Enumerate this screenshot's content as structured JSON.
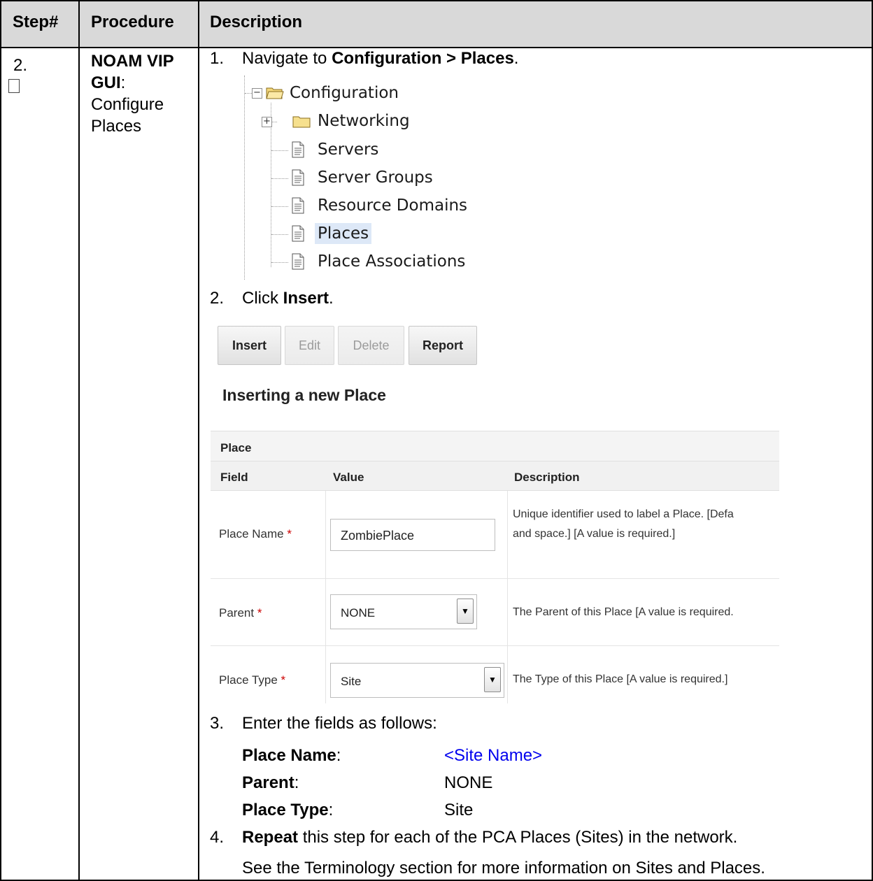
{
  "table": {
    "headers": [
      "Step#",
      "Procedure",
      "Description"
    ],
    "step_number": "2.",
    "procedure_bold": "NOAM VIP GUI",
    "procedure_colon": ":",
    "procedure_rest_1": "Configure",
    "procedure_rest_2": "Places"
  },
  "instructions": {
    "s1_num": "1.",
    "s1_pre": "Navigate to ",
    "s1_bold": "Configuration > Places",
    "s1_post": ".",
    "s2_num": "2.",
    "s2_pre": "Click ",
    "s2_bold": "Insert",
    "s2_post": ".",
    "s3_num": "3.",
    "s3_text": "Enter the fields as follows:",
    "s4_num": "4.",
    "s4_bold": "Repeat",
    "s4_rest": " this step for each of the PCA Places (Sites) in the network.",
    "note": "See the Terminology section for more information on Sites and Places."
  },
  "tree": {
    "root": "Configuration",
    "items": [
      "Networking",
      "Servers",
      "Server Groups",
      "Resource Domains",
      "Places",
      "Place Associations"
    ],
    "selected": "Places",
    "collapse_symbol": "−",
    "expand_symbol": "+"
  },
  "toolbar": {
    "insert": "Insert",
    "edit": "Edit",
    "delete": "Delete",
    "report": "Report"
  },
  "form": {
    "title": "Inserting a new Place",
    "section": "Place",
    "columns": [
      "Field",
      "Value",
      "Description"
    ],
    "required_mark": "*",
    "rows": [
      {
        "label": "Place Name",
        "value": "ZombiePlace",
        "desc_line1": "Unique identifier used to label a Place. [Defa",
        "desc_line2": "and space.] [A value is required.]"
      },
      {
        "label": "Parent",
        "value": "NONE",
        "desc_line1": "The Parent of this Place [A value is required."
      },
      {
        "label": "Place Type",
        "value": "Site",
        "desc_line1": "The Type of this Place [A value is required.]"
      }
    ]
  },
  "field_values": [
    {
      "label": "Place Name",
      "value": "<Site Name>"
    },
    {
      "label": "Parent",
      "value": "NONE"
    },
    {
      "label": "Place Type",
      "value": "Site"
    }
  ],
  "colors": {
    "header_bg": "#d9d9d9",
    "link_blue": "#0000ee",
    "selected_bg": "#dde8f7"
  }
}
